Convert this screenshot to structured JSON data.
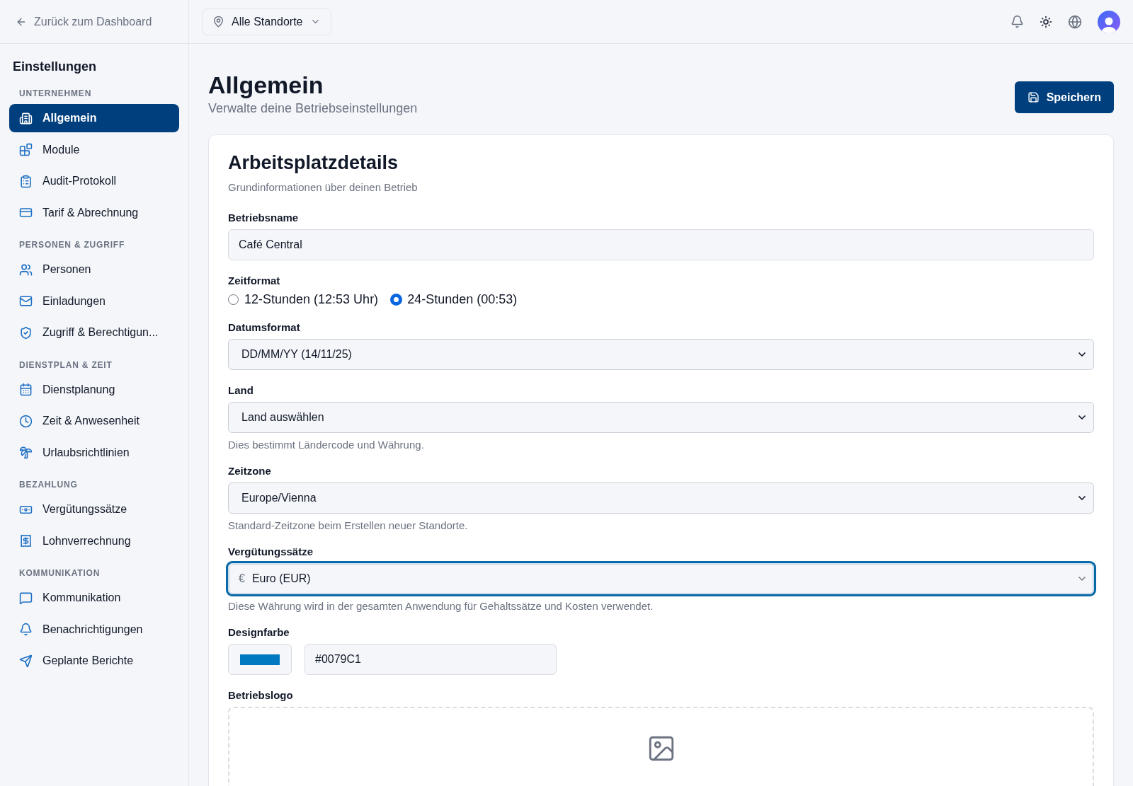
{
  "topbar": {
    "back_link": "Zurück zum Dashboard",
    "location_selector": "Alle Standorte"
  },
  "sidebar": {
    "title": "Einstellungen",
    "sections": [
      {
        "heading": "UNTERNEHMEN",
        "items": [
          {
            "label": "Allgemein",
            "selected": true
          },
          {
            "label": "Module",
            "selected": false
          },
          {
            "label": "Audit-Protokoll",
            "selected": false
          },
          {
            "label": "Tarif & Abrechnung",
            "selected": false
          }
        ]
      },
      {
        "heading": "PERSONEN & ZUGRIFF",
        "items": [
          {
            "label": "Personen",
            "selected": false
          },
          {
            "label": "Einladungen",
            "selected": false
          },
          {
            "label": "Zugriff & Berechtigun...",
            "selected": false
          }
        ]
      },
      {
        "heading": "DIENSTPLAN & ZEIT",
        "items": [
          {
            "label": "Dienstplanung",
            "selected": false
          },
          {
            "label": "Zeit & Anwesenheit",
            "selected": false
          },
          {
            "label": "Urlaubsrichtlinien",
            "selected": false
          }
        ]
      },
      {
        "heading": "BEZAHLUNG",
        "items": [
          {
            "label": "Vergütungssätze",
            "selected": false
          },
          {
            "label": "Lohnverrechnung",
            "selected": false
          }
        ]
      },
      {
        "heading": "KOMMUNIKATION",
        "items": [
          {
            "label": "Kommunikation",
            "selected": false
          },
          {
            "label": "Benachrichtigungen",
            "selected": false
          },
          {
            "label": "Geplante Berichte",
            "selected": false
          }
        ]
      }
    ]
  },
  "page": {
    "title": "Allgemein",
    "subtitle": "Verwalte deine Betriebseinstellungen",
    "save_button": "Speichern"
  },
  "card": {
    "title": "Arbeitsplatzdetails",
    "subtitle": "Grundinformationen über deinen Betrieb",
    "fields": [
      {
        "kind": "text",
        "label": "Betriebsname",
        "value": "Café Central"
      },
      {
        "kind": "radio",
        "label": "Zeitformat",
        "options": [
          {
            "label": "12-Stunden (12:53 Uhr)",
            "selected": false
          },
          {
            "label": "24-Stunden (00:53)",
            "selected": true
          }
        ]
      },
      {
        "kind": "select",
        "label": "Datumsformat",
        "value": "DD/MM/YY (14/11/25)"
      },
      {
        "kind": "select",
        "label": "Land",
        "value": "Land auswählen",
        "help": "Dies bestimmt Ländercode und Währung."
      },
      {
        "kind": "select",
        "label": "Zeitzone",
        "value": "Europe/Vienna",
        "help": "Standard-Zeitzone beim Erstellen neuer Standorte."
      },
      {
        "kind": "combobox",
        "label": "Vergütungssätze",
        "prefix": "€",
        "value": "Euro (EUR)",
        "focused": true,
        "help": "Diese Währung wird in der gesamten Anwendung für Gehaltssätze und Kosten verwendet."
      },
      {
        "kind": "color",
        "label": "Designfarbe",
        "color": "#0079c1",
        "value": "#0079C1"
      },
      {
        "kind": "upload",
        "label": "Betriebslogo"
      }
    ]
  }
}
